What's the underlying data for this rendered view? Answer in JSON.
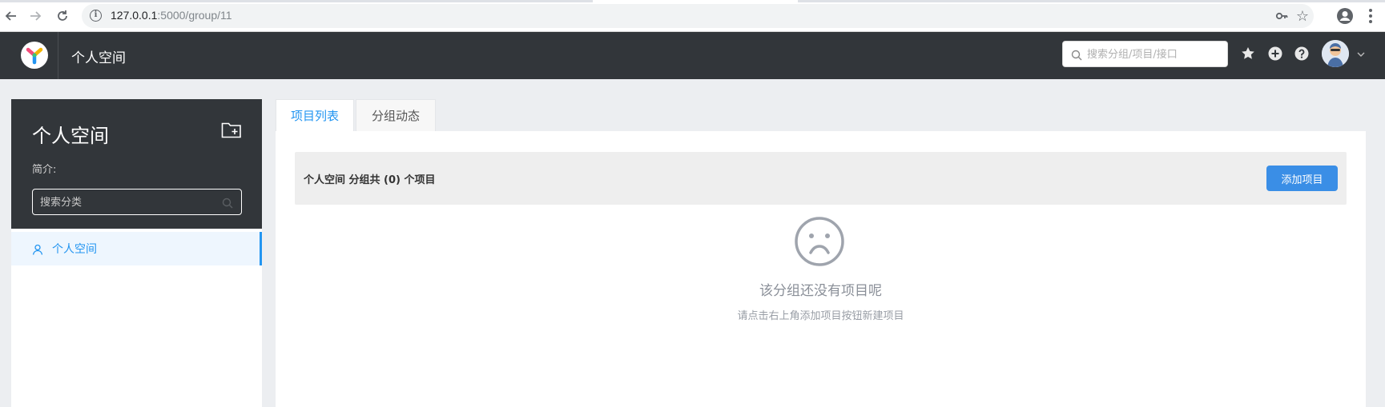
{
  "browser": {
    "back_icon": "arrow-left-icon",
    "forward_icon": "arrow-right-icon",
    "reload_icon": "reload-icon",
    "url_host": "127.0.0.1",
    "url_rest": ":5000/group/11"
  },
  "header": {
    "title": "个人空间",
    "search_placeholder": "搜索分组/项目/接口",
    "icons": [
      "star-icon",
      "plus-circle-icon",
      "help-icon",
      "avatar",
      "chevron-down-icon"
    ]
  },
  "sidebar": {
    "title": "个人空间",
    "description_label": "简介:",
    "search_placeholder": "搜索分类",
    "items": [
      {
        "label": "个人空间",
        "icon": "user-icon",
        "active": true
      }
    ]
  },
  "tabs": [
    {
      "label": "项目列表",
      "active": true
    },
    {
      "label": "分组动态",
      "active": false
    }
  ],
  "projects": {
    "summary": "个人空间 分组共 (0) 个项目",
    "add_button": "添加项目"
  },
  "empty": {
    "title": "该分组还没有项目呢",
    "hint": "请点击右上角添加项目按钮新建项目"
  },
  "colors": {
    "accent": "#2395f1",
    "header_bg": "#32363a",
    "button_bg": "#3a8ee6"
  }
}
